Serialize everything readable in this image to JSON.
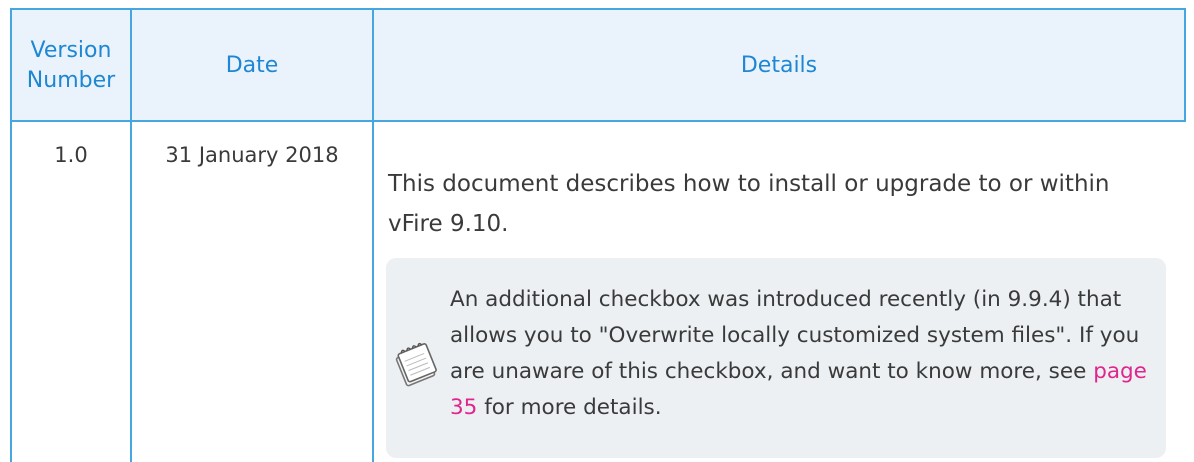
{
  "table": {
    "headers": {
      "version_line1": "Version",
      "version_line2": "Number",
      "date": "Date",
      "details": "Details"
    },
    "rows": [
      {
        "version": "1.0",
        "date": "31 January 2018",
        "details": "This document describes how to install or upgrade to or within vFire 9.10.",
        "note": {
          "icon": "notepad-icon",
          "text_before_link": "An additional checkbox was introduced recently (in 9.9.4) that allows you to \"Overwrite locally customized system files\". If you are unaware of this checkbox, and want to know more, see ",
          "link_text": "page 35",
          "text_after_link": " for more details."
        }
      }
    ]
  },
  "colors": {
    "border": "#45a6e0",
    "header_text": "#1e87d4",
    "header_bg": "#eaf3fb",
    "link": "#e0258d",
    "note_bg": "#ecf0f3"
  }
}
